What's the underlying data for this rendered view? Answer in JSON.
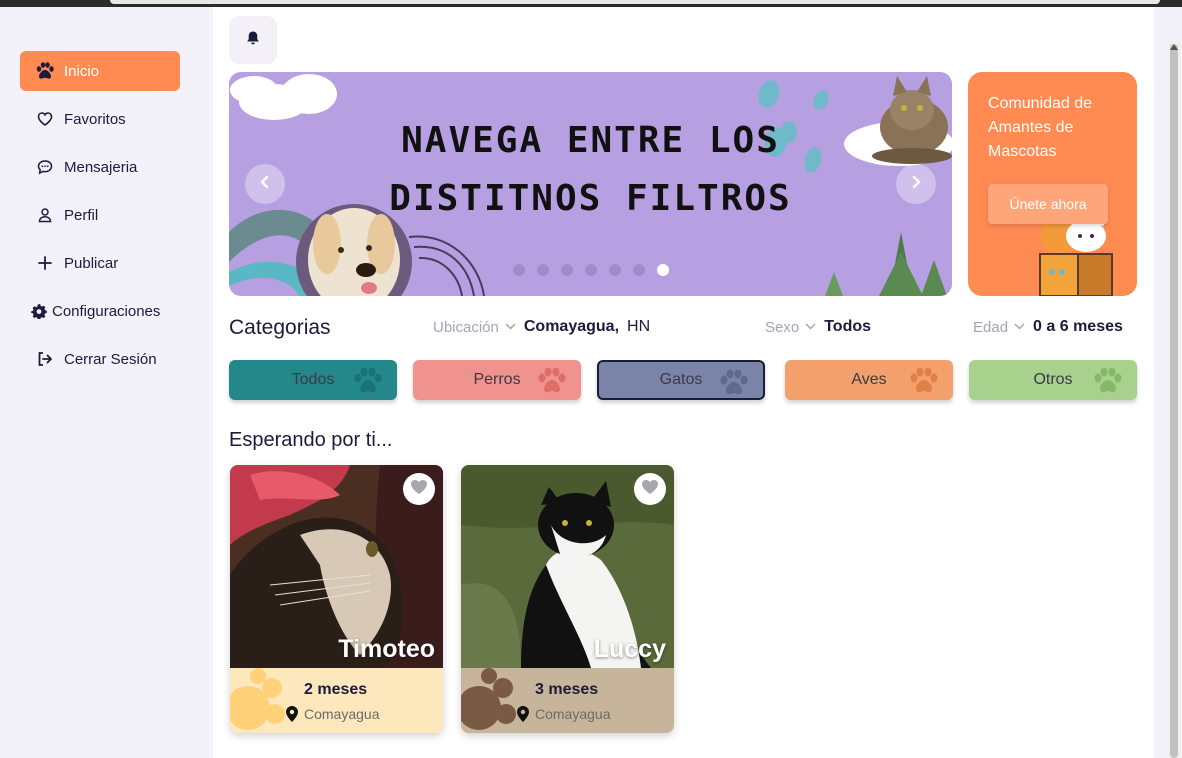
{
  "sidebar": {
    "items": [
      {
        "label": "Inicio",
        "icon": "paw-icon"
      },
      {
        "label": "Favoritos",
        "icon": "heart-icon"
      },
      {
        "label": "Mensajeria",
        "icon": "chat-icon"
      },
      {
        "label": "Perfil",
        "icon": "user-icon"
      },
      {
        "label": "Publicar",
        "icon": "plus-icon"
      },
      {
        "label": "Configuraciones",
        "icon": "gear-icon"
      },
      {
        "label": "Cerrar Sesión",
        "icon": "logout-icon"
      }
    ]
  },
  "banner": {
    "line1": "NAVEGA ENTRE LOS",
    "line2": "DISTITNOS FILTROS",
    "slides": 7,
    "active_slide": 7
  },
  "promo": {
    "text": "Comunidad de Amantes de Mascotas",
    "button": "Únete ahora"
  },
  "categories": {
    "title": "Categorias",
    "items": [
      {
        "label": "Todos",
        "color": "#24888a"
      },
      {
        "label": "Perros",
        "color": "#f0928e"
      },
      {
        "label": "Gatos",
        "color": "#7a83a8"
      },
      {
        "label": "Aves",
        "color": "#f4a06c"
      },
      {
        "label": "Otros",
        "color": "#a9d18e"
      }
    ]
  },
  "filters": {
    "location_label": "Ubicación",
    "location_city": "Comayagua,",
    "location_country": "HN",
    "sex_label": "Sexo",
    "sex_value": "Todos",
    "age_label": "Edad",
    "age_value": "0 a 6 meses"
  },
  "section": {
    "title": "Esperando por ti..."
  },
  "pets": [
    {
      "name": "Timoteo",
      "age": "2 meses",
      "location": "Comayagua",
      "info_color": "#fde7bd"
    },
    {
      "name": "Luccy",
      "age": "3 meses",
      "location": "Comayagua",
      "info_color": "#c6b49b"
    }
  ]
}
